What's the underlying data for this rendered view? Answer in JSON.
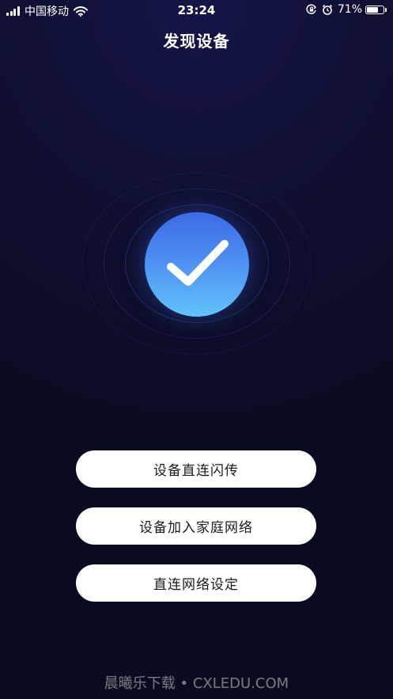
{
  "status_bar": {
    "carrier": "中国移动",
    "time": "23:24",
    "battery_percent": "71%",
    "battery_level": 0.71
  },
  "header": {
    "title": "发现设备"
  },
  "actions": [
    {
      "label": "设备直连闪传"
    },
    {
      "label": "设备加入家庭网络"
    },
    {
      "label": "直连网络设定"
    }
  ],
  "watermark": {
    "text": "晨曦乐下载 • CXLEDU.COM"
  },
  "colors": {
    "background": "#0e0f30",
    "accent_top": "#3d6ae6",
    "accent_bottom": "#62c4fb",
    "button_bg": "#ffffff"
  },
  "icons": {
    "signal": "signal-bars-icon",
    "wifi": "wifi-icon",
    "orientation_lock": "orientation-lock-icon",
    "alarm": "alarm-clock-icon",
    "battery": "battery-icon",
    "success": "checkmark-icon"
  }
}
